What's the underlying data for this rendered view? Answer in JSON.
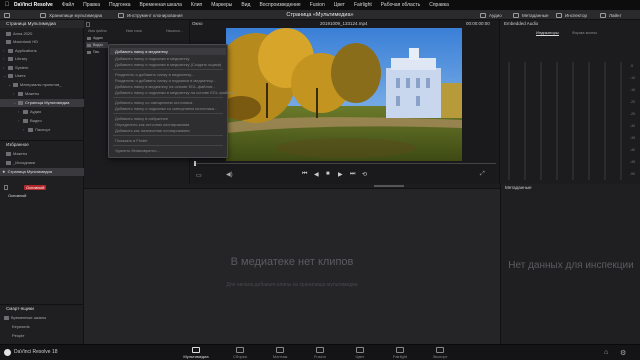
{
  "menubar": {
    "app": "DaVinci Resolve",
    "items": [
      "Файл",
      "Правка",
      "Подгонка",
      "Временная шкала",
      "Клип",
      "Маркеры",
      "Вид",
      "Воспроизведение",
      "Fusion",
      "Цвет",
      "Fairlight",
      "Рабочая область",
      "Справка"
    ]
  },
  "toolbar": {
    "media_storage": "Хранилище мультимедиа",
    "clone": "Инструмент клонирования",
    "page_title": "Страница «Мультимедиа»",
    "audio": "Аудио",
    "metadata": "Метаданные",
    "inspector": "Инспектор",
    "tab": "Лайнт"
  },
  "storage": {
    "header": "Страница Мультимедиа",
    "locations": [
      "Anna 2020",
      "Macintosh HD",
      "Applications",
      "Library",
      "System",
      "Users",
      "Материалы проектов_",
      "Макеты",
      "Страница Мультимедиа",
      "Аудио",
      "Видео",
      "Паспорт"
    ]
  },
  "mediapool": {
    "col_name": "Имя файла",
    "col_type": "Имя тома",
    "col_date": "Начальн...",
    "rows": [
      "Аудио",
      "Видео",
      "Пас"
    ]
  },
  "context_menu": {
    "items": [
      "Добавить папку в медиатеку",
      "Добавить папку и подпапки в медиатеку",
      "Добавить папку и подпапки в медиатеку (Создать ящики)",
      "Разделить и добавить папку в медиатеку...",
      "Разделить и добавить папку и подпапки в медиатеку...",
      "Добавить папку в медиатеку на основе EDL-файлов...",
      "Добавить папку и подпапки в медиатеку на основе EDL-файлов...",
      "Добавить папку со смещением источника",
      "Добавить папку и подпапки со смещением источника...",
      "Добавить папку в избранное",
      "Определить как источник клонирования",
      "Добавить как назначение клонирования",
      "Показать в Finder",
      "Удалить безвозвратно..."
    ]
  },
  "viewer": {
    "label": "Окно",
    "filename": "20191009_133124.mp4",
    "timecode": "00:00:00:00",
    "fit": "Вписать"
  },
  "inspector": {
    "header": "Embedded Audio",
    "tab_indicators": "Индикаторы",
    "tab_waveform": "Форма волны",
    "scale": [
      "-5",
      "-10",
      "-15",
      "-20",
      "-25",
      "-30",
      "-35",
      "-40",
      "-45",
      "-50"
    ]
  },
  "favorites": {
    "header": "Избранное",
    "items": [
      "Макеты",
      "_Исходники",
      "Страница Мультимедиа"
    ]
  },
  "bins": {
    "label": "Основной",
    "badge": "Основной"
  },
  "lower": {
    "empty_pool": "В медиатеке нет клипов",
    "empty_hint": "Для начала добавьте клипы из хранилища мультимедиа",
    "empty_inspect": "Нет данных для инспекции",
    "metadata_header": "Метаданные"
  },
  "smart_bins": {
    "header": "Смарт-ящики",
    "items": [
      "Временные шкалы",
      "Keywords",
      "People"
    ]
  },
  "bottombar": {
    "version": "DaVinci Resolve 18",
    "tabs": [
      "Мультимедиа",
      "Сборка",
      "Монтаж",
      "Fusion",
      "Цвет",
      "Fairlight",
      "Экспорт"
    ]
  }
}
